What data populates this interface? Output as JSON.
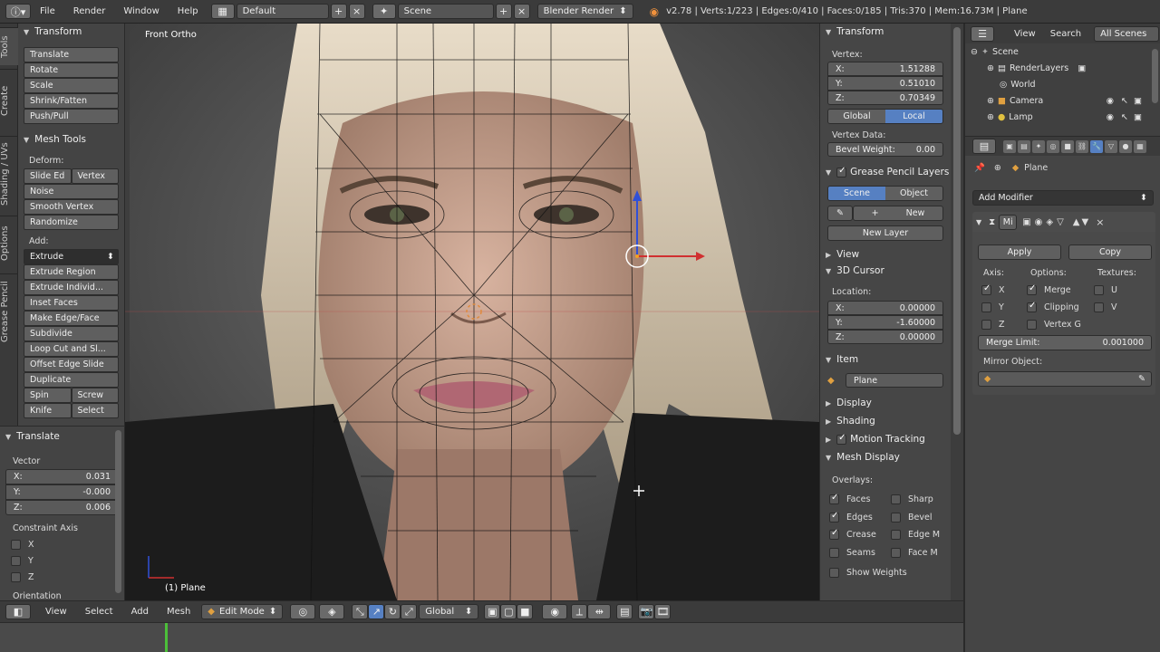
{
  "topbar": {
    "menus": [
      "File",
      "Render",
      "Window",
      "Help"
    ],
    "layout": "Default",
    "scene": "Scene",
    "engine": "Blender Render",
    "stats": "v2.78 | Verts:1/223 | Edges:0/410 | Faces:0/185 | Tris:370 | Mem:16.73M | Plane"
  },
  "tabs": [
    "Tools",
    "Create",
    "Shading / UVs",
    "Options",
    "Grease Pencil"
  ],
  "toolshelf": {
    "transform_title": "Transform",
    "transform_buttons": [
      "Translate",
      "Rotate",
      "Scale",
      "Shrink/Fatten",
      "Push/Pull"
    ],
    "meshtools_title": "Mesh Tools",
    "deform_label": "Deform:",
    "slide_edge": "Slide Ed",
    "vertex": "Vertex",
    "deform_buttons": [
      "Noise",
      "Smooth Vertex",
      "Randomize"
    ],
    "add_label": "Add:",
    "extrude": "Extrude",
    "add_buttons": [
      "Extrude Region",
      "Extrude Individ...",
      "Inset Faces",
      "Make Edge/Face",
      "Subdivide",
      "Loop Cut and Sl...",
      "Offset Edge Slide",
      "Duplicate"
    ],
    "spin": "Spin",
    "screw": "Screw",
    "knife": "Knife",
    "select": "Select"
  },
  "operator": {
    "title": "Translate",
    "vector_label": "Vector",
    "x_label": "X:",
    "x": "0.031",
    "y_label": "Y:",
    "y": "-0.000",
    "z_label": "Z:",
    "z": "0.006",
    "constraint_label": "Constraint Axis",
    "axes": [
      "X",
      "Y",
      "Z"
    ],
    "orientation_label": "Orientation"
  },
  "viewport": {
    "view_name": "Front Ortho",
    "object_label": "(1) Plane"
  },
  "npanel": {
    "transform_title": "Transform",
    "vertex_label": "Vertex:",
    "vx_label": "X:",
    "vx": "1.51288",
    "vy_label": "Y:",
    "vy": "0.51010",
    "vz_label": "Z:",
    "vz": "0.70349",
    "global": "Global",
    "local": "Local",
    "vertex_data_label": "Vertex Data:",
    "bevel_weight_label": "Bevel Weight:",
    "bevel_weight": "0.00",
    "grease_title": "Grease Pencil Layers",
    "scene_btn": "Scene",
    "object_btn": "Object",
    "new_btn": "New",
    "new_layer_btn": "New Layer",
    "view_title": "View",
    "cursor_title": "3D Cursor",
    "location_label": "Location:",
    "cx_label": "X:",
    "cx": "0.00000",
    "cy_label": "Y:",
    "cy": "-1.60000",
    "cz_label": "Z:",
    "cz": "0.00000",
    "item_title": "Item",
    "item_name": "Plane",
    "display_title": "Display",
    "shading_title": "Shading",
    "motion_title": "Motion Tracking",
    "meshdisplay_title": "Mesh Display",
    "overlays_label": "Overlays:",
    "overlays_left": [
      "Faces",
      "Edges",
      "Crease",
      "Seams"
    ],
    "overlays_right": [
      "Sharp",
      "Bevel",
      "Edge M",
      "Face M"
    ],
    "show_weights": "Show Weights"
  },
  "outliner": {
    "menus": [
      "View",
      "Search"
    ],
    "scope": "All Scenes",
    "items": [
      "Scene",
      "RenderLayers",
      "World",
      "Camera",
      "Lamp"
    ]
  },
  "properties": {
    "object_name": "Plane",
    "add_modifier": "Add Modifier",
    "mod_short": "Mi",
    "apply": "Apply",
    "copy": "Copy",
    "axis_label": "Axis:",
    "options_label": "Options:",
    "textures_label": "Textures:",
    "axes": [
      "X",
      "Y",
      "Z"
    ],
    "merge": "Merge",
    "clipping": "Clipping",
    "vertex_g": "Vertex G",
    "tex_u": "U",
    "tex_v": "V",
    "merge_limit_label": "Merge Limit:",
    "merge_limit": "0.001000",
    "mirror_object_label": "Mirror Object:"
  },
  "bottombar": {
    "menus": [
      "View",
      "Select",
      "Add",
      "Mesh"
    ],
    "mode": "Edit Mode",
    "orientation": "Global"
  },
  "colors": {
    "accent": "#5680c2",
    "timeline_cursor": "#4cbf3a"
  }
}
